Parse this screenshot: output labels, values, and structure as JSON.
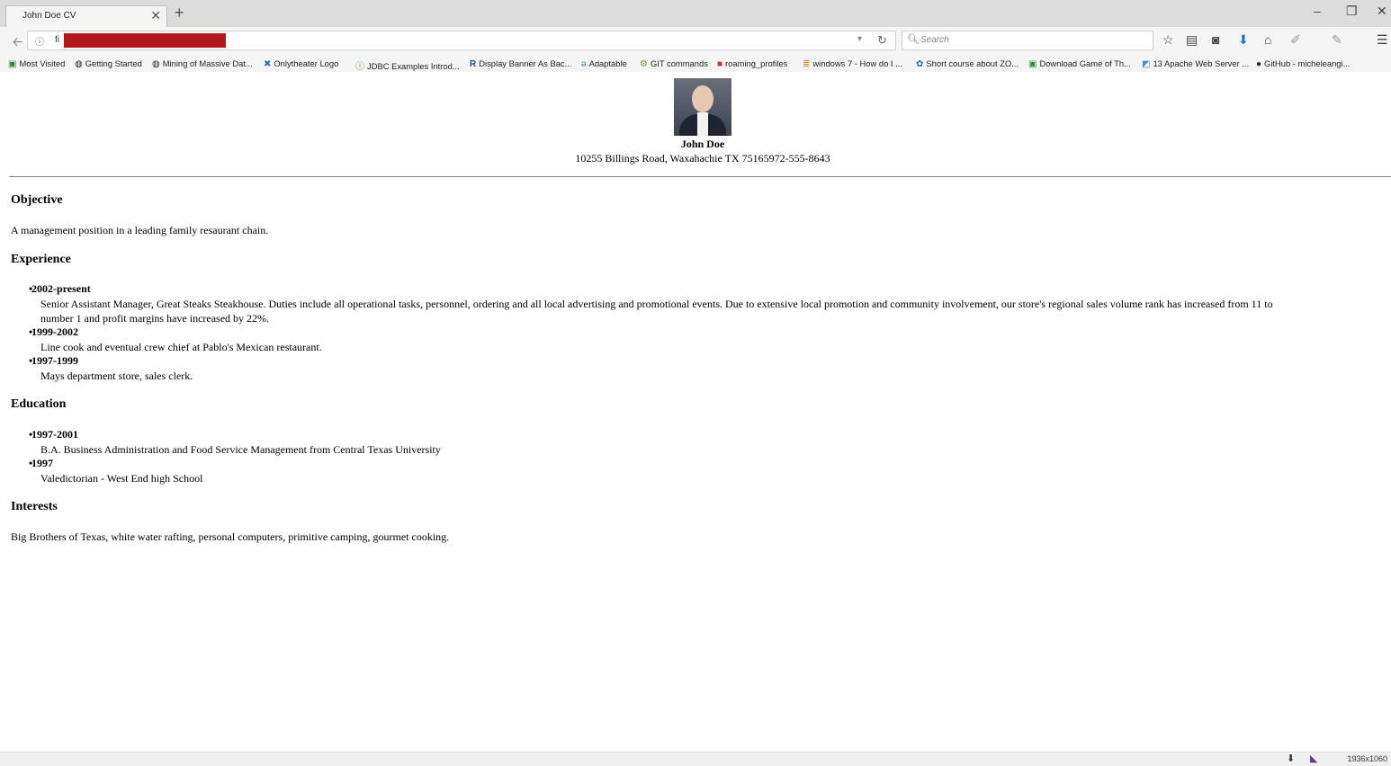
{
  "browser": {
    "tab_title": "John Doe CV",
    "url_prefix": "fi",
    "search_placeholder": "Search",
    "icons": {
      "back": "back-arrow-icon",
      "info": "info-icon",
      "reload": "reload-icon",
      "search": "search-icon",
      "bookmark_star": "star-icon",
      "reader": "reader-icon",
      "pocket": "pocket-icon",
      "download": "download-icon",
      "home": "home-icon",
      "menu": "hamburger-menu-icon"
    },
    "bookmarks": [
      {
        "label": "Most Visited",
        "icon": "folder-icon"
      },
      {
        "label": "Getting Started",
        "icon": "globe-icon"
      },
      {
        "label": "Mining of Massive Dat...",
        "icon": "globe-icon"
      },
      {
        "label": "Onlytheater Logo",
        "icon": "x-icon"
      },
      {
        "label": "JDBC Examples Introd...",
        "icon": "info-icon"
      },
      {
        "label": "Display Banner As Bac...",
        "icon": "r-icon"
      },
      {
        "label": "Adaptable",
        "icon": "ie-icon"
      },
      {
        "label": "GIT commands",
        "icon": "gear-icon"
      },
      {
        "label": "roaming_profiles",
        "icon": "red-square-icon"
      },
      {
        "label": "windows 7 - How do I ...",
        "icon": "stack-icon"
      },
      {
        "label": "Short course about ZO...",
        "icon": "mixed-icon"
      },
      {
        "label": "Download Game of Th...",
        "icon": "green-square-icon"
      },
      {
        "label": "13 Apache Web Server ...",
        "icon": "image-icon"
      },
      {
        "label": "GitHub - micheleangi...",
        "icon": "github-icon"
      }
    ],
    "status_size": "1936x1060"
  },
  "cv": {
    "name": "John Doe",
    "address": "10255 Billings Road, Waxahachie TX 75165972-555-8643",
    "objective": {
      "heading": "Objective",
      "text": "A management position in a leading family resaurant chain."
    },
    "experience": {
      "heading": "Experience",
      "items": [
        {
          "period": "2002-present",
          "description_line1": "Senior Assistant Manager, Great Steaks Steakhouse. Duties include all operational tasks, personnel, ordering and all local advertising and promotional events. Due to extensive local promotion and community involvement, our store's regional sales volume rank has increased from 11 to",
          "description_line2": "number 1 and profit margins have increased by 22%."
        },
        {
          "period": "1999-2002",
          "description_line1": "Line cook and eventual crew chief at Pablo's Mexican restaurant."
        },
        {
          "period": "1997-1999",
          "description_line1": "Mays department store, sales clerk."
        }
      ]
    },
    "education": {
      "heading": "Education",
      "items": [
        {
          "period": "1997-2001",
          "description": "B.A. Business Administration and Food Service Management from Central Texas University"
        },
        {
          "period": "1997",
          "description": "Valedictorian - West End high School"
        }
      ]
    },
    "interests": {
      "heading": "Interests",
      "text": "Big Brothers of Texas, white water rafting, personal computers, primitive camping, gourmet cooking."
    }
  }
}
